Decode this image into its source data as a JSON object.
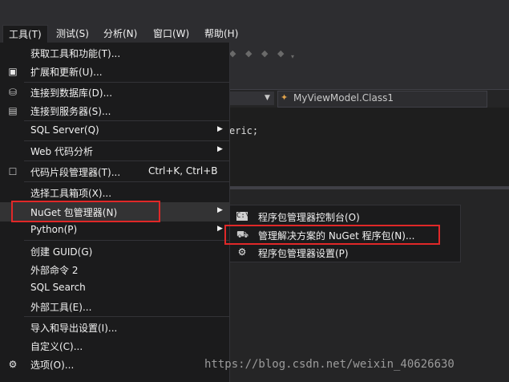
{
  "menubar": {
    "items": [
      {
        "label": "工具(T)"
      },
      {
        "label": "测试(S)"
      },
      {
        "label": "分析(N)"
      },
      {
        "label": "窗口(W)"
      },
      {
        "label": "帮助(H)"
      }
    ]
  },
  "tools_menu": {
    "items": [
      {
        "label": "获取工具和功能(T)..."
      },
      {
        "label": "扩展和更新(U)..."
      },
      {
        "label": "连接到数据库(D)..."
      },
      {
        "label": "连接到服务器(S)..."
      },
      {
        "label": "SQL Server(Q)"
      },
      {
        "label": "Web 代码分析"
      },
      {
        "label": "代码片段管理器(T)...",
        "shortcut": "Ctrl+K, Ctrl+B"
      },
      {
        "label": "选择工具箱项(X)..."
      },
      {
        "label": "NuGet 包管理器(N)"
      },
      {
        "label": "Python(P)"
      },
      {
        "label": "创建 GUID(G)"
      },
      {
        "label": "外部命令 2"
      },
      {
        "label": "SQL Search"
      },
      {
        "label": "外部工具(E)..."
      },
      {
        "label": "导入和导出设置(I)..."
      },
      {
        "label": "自定义(C)..."
      },
      {
        "label": "选项(O)..."
      }
    ]
  },
  "nuget_submenu": {
    "items": [
      {
        "label": "程序包管理器控制台(O)"
      },
      {
        "label": "管理解决方案的 NuGet 程序包(N)..."
      },
      {
        "label": "程序包管理器设置(P)"
      }
    ]
  },
  "editor": {
    "nav_class": "MyViewModel.Class1",
    "code_fragment": "eric;"
  },
  "watermark": "https://blog.csdn.net/weixin_40626630",
  "colors": {
    "menu_bg": "#1b1b1c",
    "hover_bg": "#333334",
    "highlight_border": "#e02828",
    "text": "#f1f1f1"
  }
}
